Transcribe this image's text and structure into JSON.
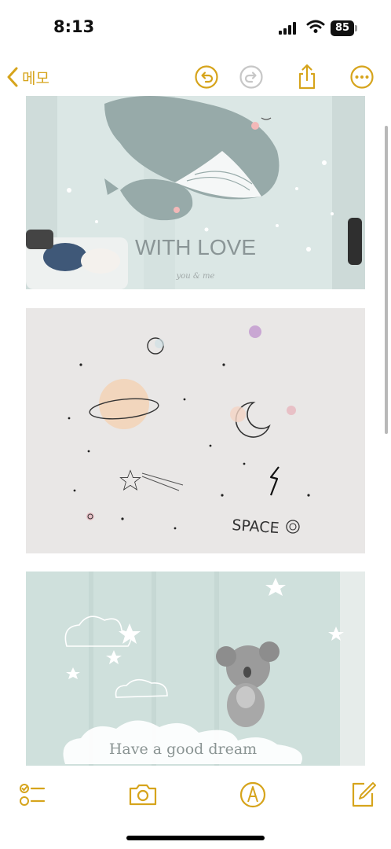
{
  "status_bar": {
    "time": "8:13",
    "battery": "85",
    "icons": [
      "cellular-signal-icon",
      "wifi-icon",
      "battery-icon"
    ]
  },
  "nav_bar": {
    "back_label": "메모",
    "icons": [
      "chevron-left-icon",
      "undo-icon",
      "redo-icon",
      "share-icon",
      "more-icon"
    ],
    "accent_color": "#d6a41c",
    "disabled_color": "#c7c7c7"
  },
  "note": {
    "images": [
      {
        "alt": "whale wall mural",
        "caption": "WITH LOVE",
        "subcaption": "you & me"
      },
      {
        "alt": "space wall mural",
        "caption": "SPACE"
      },
      {
        "alt": "koala moon wall mural",
        "caption": "Have a good dream"
      }
    ]
  },
  "toolbar": {
    "icons": [
      "checklist-icon",
      "camera-icon",
      "markup-icon",
      "compose-icon"
    ]
  }
}
